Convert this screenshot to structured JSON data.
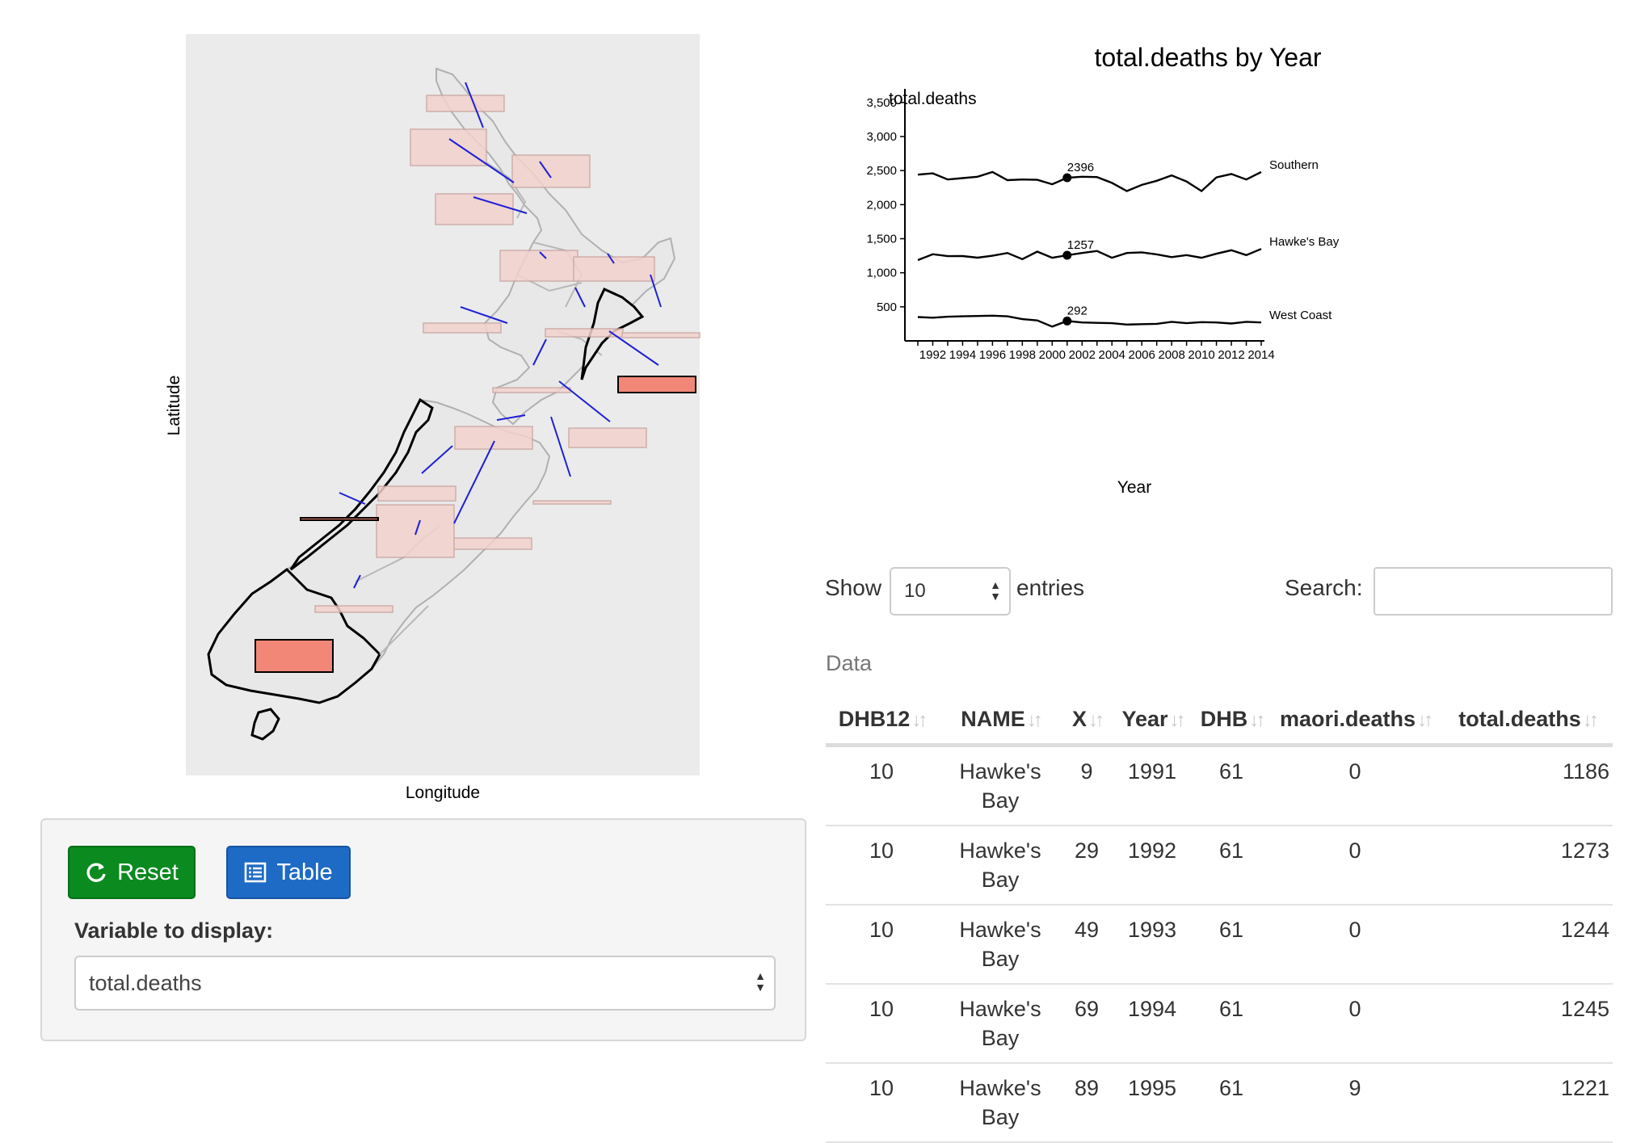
{
  "map": {
    "xlabel": "Longitude",
    "ylabel": "Latitude",
    "colors": {
      "background": "#ebebeb",
      "region_fill": "#e8e8e8",
      "highlight_fill": "#f28777",
      "bar_fill": "#f3d2cc",
      "segment": "#1f1fd6"
    }
  },
  "controls": {
    "reset_label": "Reset",
    "table_label": "Table",
    "variable_label": "Variable to display:",
    "variable_value": "total.deaths"
  },
  "chart_data": {
    "type": "line",
    "title": "total.deaths by Year",
    "ylabel": "total.deaths",
    "xlabel": "Year",
    "x": [
      1991,
      1992,
      1993,
      1994,
      1995,
      1996,
      1997,
      1998,
      1999,
      2000,
      2001,
      2002,
      2003,
      2004,
      2005,
      2006,
      2007,
      2008,
      2009,
      2010,
      2011,
      2012,
      2013,
      2014
    ],
    "xticks": [
      "1992",
      "1994",
      "1996",
      "1998",
      "2000",
      "2002",
      "2004",
      "2006",
      "2008",
      "2010",
      "2012",
      "2014"
    ],
    "yticks": [
      "500",
      "1,000",
      "1,500",
      "2,000",
      "2,500",
      "3,000",
      "3,500"
    ],
    "ylim": [
      0,
      3700
    ],
    "series": [
      {
        "name": "Southern",
        "values": [
          2440,
          2460,
          2370,
          2390,
          2410,
          2480,
          2360,
          2370,
          2365,
          2300,
          2396,
          2410,
          2405,
          2320,
          2200,
          2290,
          2350,
          2430,
          2340,
          2200,
          2400,
          2450,
          2370,
          2480
        ]
      },
      {
        "name": "Hawke's Bay",
        "values": [
          1186,
          1273,
          1244,
          1245,
          1221,
          1250,
          1290,
          1200,
          1310,
          1220,
          1257,
          1290,
          1320,
          1220,
          1290,
          1300,
          1270,
          1230,
          1260,
          1220,
          1280,
          1330,
          1260,
          1350
        ]
      },
      {
        "name": "West Coast",
        "values": [
          350,
          340,
          355,
          360,
          365,
          370,
          360,
          320,
          300,
          210,
          292,
          270,
          265,
          260,
          240,
          245,
          250,
          280,
          260,
          275,
          270,
          255,
          280,
          270
        ]
      }
    ],
    "highlight": {
      "x": 2001,
      "labels": [
        "2396",
        "1257",
        "292"
      ]
    }
  },
  "table_controls": {
    "show_label": "Show",
    "page_length": "10",
    "entries_label": "entries",
    "search_label": "Search:",
    "search_value": ""
  },
  "table": {
    "caption": "Data",
    "columns": [
      "DHB12",
      "NAME",
      "X",
      "Year",
      "DHB",
      "maori.deaths",
      "total.deaths"
    ],
    "rows": [
      [
        "10",
        "Hawke's Bay",
        "9",
        "1991",
        "61",
        "0",
        "1186"
      ],
      [
        "10",
        "Hawke's Bay",
        "29",
        "1992",
        "61",
        "0",
        "1273"
      ],
      [
        "10",
        "Hawke's Bay",
        "49",
        "1993",
        "61",
        "0",
        "1244"
      ],
      [
        "10",
        "Hawke's Bay",
        "69",
        "1994",
        "61",
        "0",
        "1245"
      ],
      [
        "10",
        "Hawke's Bay",
        "89",
        "1995",
        "61",
        "9",
        "1221"
      ]
    ]
  }
}
